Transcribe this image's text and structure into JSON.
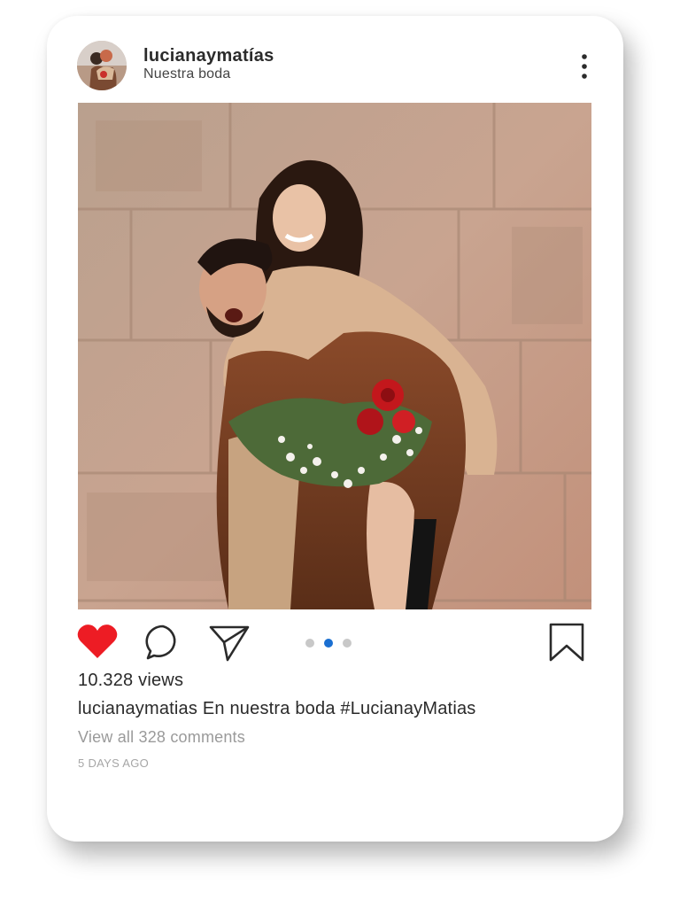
{
  "post": {
    "username": "lucianaymatías",
    "subtitle": "Nuestra boda",
    "views": "10.328 views",
    "caption_user": "lucianaymatias",
    "caption_text": "En nuestra boda #LucianayMatias",
    "view_comments": "View all 328 comments",
    "time_ago": "5 DAYS AGO"
  },
  "icons": {
    "more": "more-vertical-icon",
    "like": "heart-icon",
    "comment": "comment-bubble-icon",
    "share": "paper-plane-icon",
    "save": "bookmark-icon"
  },
  "carousel": {
    "count": 3,
    "active_index": 1
  },
  "colors": {
    "like_red": "#ed1c24",
    "dot_active": "#1a6fd1",
    "dot_inactive": "#c8c8c8"
  }
}
